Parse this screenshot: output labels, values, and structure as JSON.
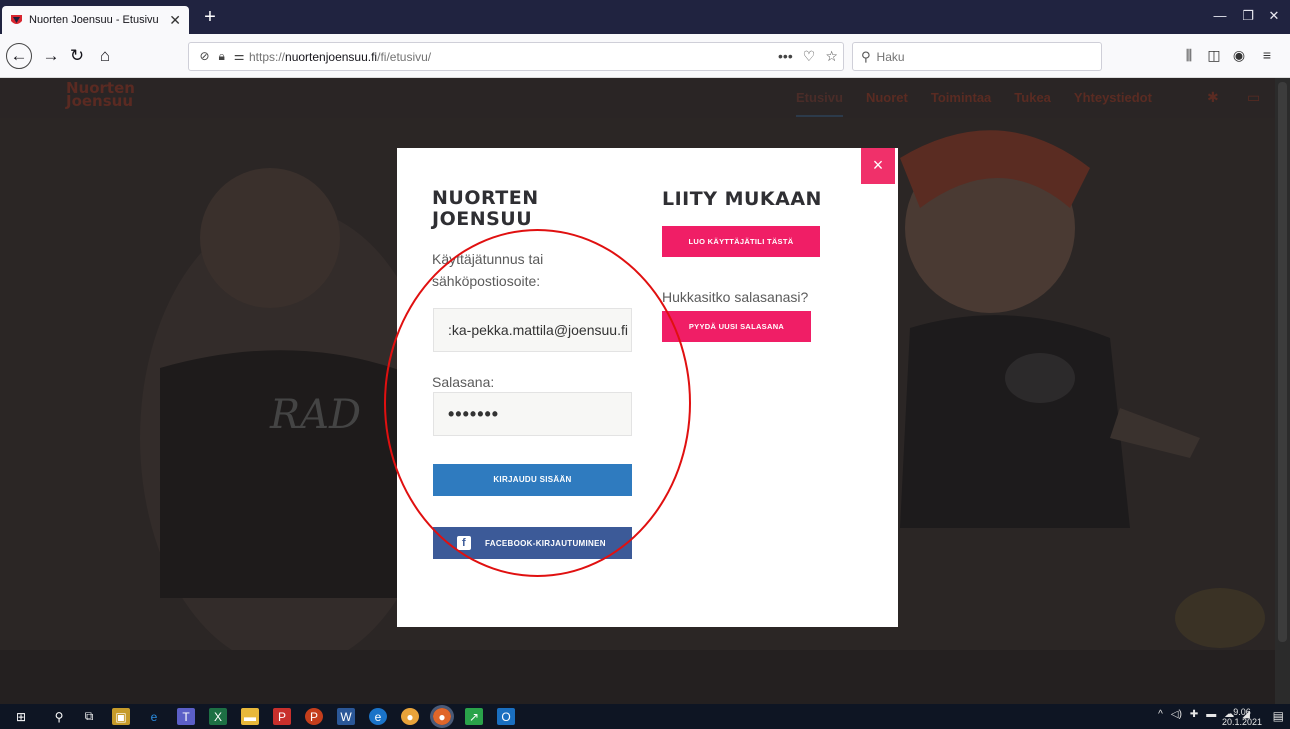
{
  "browser": {
    "tab_title": "Nuorten Joensuu - Etusivu",
    "tab_close": "✕",
    "new_tab": "+",
    "url_prefix": "https://",
    "url_host": "nuortenjoensuu.fi",
    "url_path": "/fi/etusivu/",
    "url_actions": [
      "•••",
      "♡",
      "☆"
    ],
    "search_placeholder": "Haku",
    "window_controls": [
      "—",
      "❐",
      "✕"
    ]
  },
  "site": {
    "logo": "Nuorten Joensuu",
    "menu": [
      "Etusivu",
      "Nuoret",
      "Toimintaa",
      "Tukea",
      "Yhteystiedot"
    ]
  },
  "modal": {
    "close": "×",
    "login_heading": "NUORTEN JOENSUU",
    "username_label": "Käyttäjätunnus tai sähköpostiosoite:",
    "username_value": ":ka-pekka.mattila@joensuu.fi",
    "password_label": "Salasana:",
    "password_value": "•••••••",
    "login_button": "KIRJAUDU SISÄÄN",
    "facebook_button": "FACEBOOK-KIRJAUTUMINEN",
    "join_heading": "LIITY MUKAAN",
    "create_button": "LUO KÄYTTÄJÄTILI TÄSTÄ",
    "forgot_label": "Hukkasitko salasanasi?",
    "reset_button": "PYYDÄ UUSI SALASANA"
  },
  "taskbar": {
    "time": "9.06",
    "date": "20.1.2021"
  },
  "colors": {
    "accent_pink": "#f01e66",
    "login_blue": "#2f7bbf",
    "facebook_blue": "#3c5a98",
    "annotation_red": "#e01010"
  }
}
